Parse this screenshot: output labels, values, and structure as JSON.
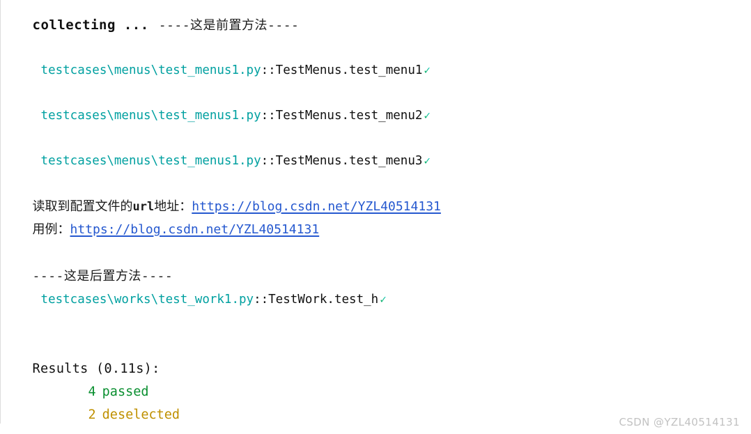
{
  "console": {
    "collecting_label": "collecting ...",
    "setup_banner": "----这是前置方法----",
    "teardown_banner": "----这是后置方法----",
    "tests": [
      {
        "path": "testcases\\menus\\test_menus1.py",
        "name": "::TestMenus.test_menu1",
        "status_glyph": "✓"
      },
      {
        "path": "testcases\\menus\\test_menus1.py",
        "name": "::TestMenus.test_menu2",
        "status_glyph": "✓"
      },
      {
        "path": "testcases\\menus\\test_menus1.py",
        "name": "::TestMenus.test_menu3",
        "status_glyph": "✓"
      }
    ],
    "teardown_test": {
      "path": "testcases\\works\\test_work1.py",
      "name": "::TestWork.test_h",
      "status_glyph": "✓"
    },
    "config_log": {
      "prefix_cjk": "读取到配置文件的",
      "prefix_mono": "url",
      "prefix_cjk_tail": "地址：",
      "url": "https://blog.csdn.net/YZL40514131"
    },
    "case_log": {
      "label": "用例：",
      "url": "https://blog.csdn.net/YZL40514131"
    },
    "results": {
      "header": "Results (0.11s):",
      "rows": [
        {
          "count": "4",
          "label": "passed"
        },
        {
          "count": "2",
          "label": "deselected"
        }
      ]
    }
  },
  "watermark": {
    "text": "CSDN @YZL40514131"
  },
  "colors": {
    "path_teal": "#00a0a0",
    "link_blue": "#2558cf",
    "passed_green": "#0a8f30",
    "deselected_olive": "#bf9000",
    "text_black": "#111111",
    "gutter_gray": "#dcdcdc",
    "watermark_gray": "#c2c2c2"
  }
}
